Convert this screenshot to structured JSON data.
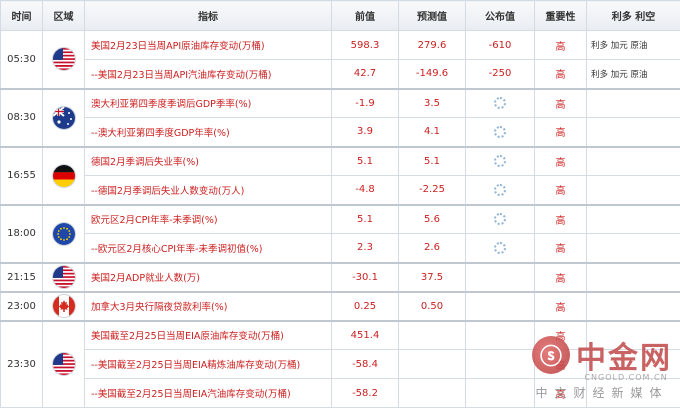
{
  "headers": [
    "时间",
    "区域",
    "指标",
    "前值",
    "预测值",
    "公布值",
    "重要性",
    "利多 利空"
  ],
  "groups": [
    {
      "time": "05:30",
      "flag": "us-flag-icon",
      "rows": [
        {
          "indicator": "美国2月23日当周API原油库存变动(万桶)",
          "previous": "598.3",
          "forecast": "279.6",
          "actual": "-610",
          "importance": "高",
          "effect": "利多  加元 原油"
        },
        {
          "indicator": "--美国2月23日当周API汽油库存变动(万桶)",
          "previous": "42.7",
          "forecast": "-149.6",
          "actual": "-250",
          "importance": "高",
          "effect": "利多  加元 原油"
        }
      ]
    },
    {
      "time": "08:30",
      "flag": "au-flag-icon",
      "rows": [
        {
          "indicator": "澳大利亚第四季度季调后GDP季率(%)",
          "previous": "-1.9",
          "forecast": "3.5",
          "actual": "",
          "importance": "高",
          "effect": ""
        },
        {
          "indicator": "--澳大利亚第四季度GDP年率(%)",
          "previous": "3.9",
          "forecast": "4.1",
          "actual": "",
          "importance": "高",
          "effect": ""
        }
      ]
    },
    {
      "time": "16:55",
      "flag": "de-flag-icon",
      "rows": [
        {
          "indicator": "德国2月季调后失业率(%)",
          "previous": "5.1",
          "forecast": "5.1",
          "actual": "",
          "importance": "高",
          "effect": ""
        },
        {
          "indicator": "--德国2月季调后失业人数变动(万人)",
          "previous": "-4.8",
          "forecast": "-2.25",
          "actual": "",
          "importance": "高",
          "effect": ""
        }
      ]
    },
    {
      "time": "18:00",
      "flag": "eu-flag-icon",
      "rows": [
        {
          "indicator": "欧元区2月CPI年率-未季调(%)",
          "previous": "5.1",
          "forecast": "5.6",
          "actual": "",
          "importance": "高",
          "effect": ""
        },
        {
          "indicator": "--欧元区2月核心CPI年率-未季调初值(%)",
          "previous": "2.3",
          "forecast": "2.6",
          "actual": "",
          "importance": "高",
          "effect": ""
        }
      ]
    },
    {
      "time": "21:15",
      "flag": "us-flag-icon",
      "rows": [
        {
          "indicator": "美国2月ADP就业人数(万)",
          "previous": "-30.1",
          "forecast": "37.5",
          "actual": "",
          "importance": "高",
          "effect": ""
        }
      ]
    },
    {
      "time": "23:00",
      "flag": "ca-flag-icon",
      "rows": [
        {
          "indicator": "加拿大3月央行隔夜贷款利率(%)",
          "previous": "0.25",
          "forecast": "0.50",
          "actual": "",
          "importance": "高",
          "effect": ""
        }
      ]
    },
    {
      "time": "23:30",
      "flag": "us-flag-icon",
      "rows": [
        {
          "indicator": "美国截至2月25日当周EIA原油库存变动(万桶)",
          "previous": "451.4",
          "forecast": "",
          "actual": "",
          "importance": "高",
          "effect": ""
        },
        {
          "indicator": "--美国截至2月25日当周EIA精炼油库存变动(万桶)",
          "previous": "-58.4",
          "forecast": "",
          "actual": "",
          "importance": "高",
          "effect": ""
        },
        {
          "indicator": "--美国截至2月25日当周EIA汽油库存变动(万桶)",
          "previous": "-58.2",
          "forecast": "",
          "actual": "",
          "importance": "高",
          "effect": ""
        }
      ]
    }
  ],
  "watermark": {
    "name": "中金网",
    "url": "CNGOLD.COM.CN",
    "sub": "中文财经新媒体"
  },
  "colors": {
    "text_red": "#cc1f1f",
    "header_bg": "#eef1f5",
    "border": "#d5dbe3"
  }
}
